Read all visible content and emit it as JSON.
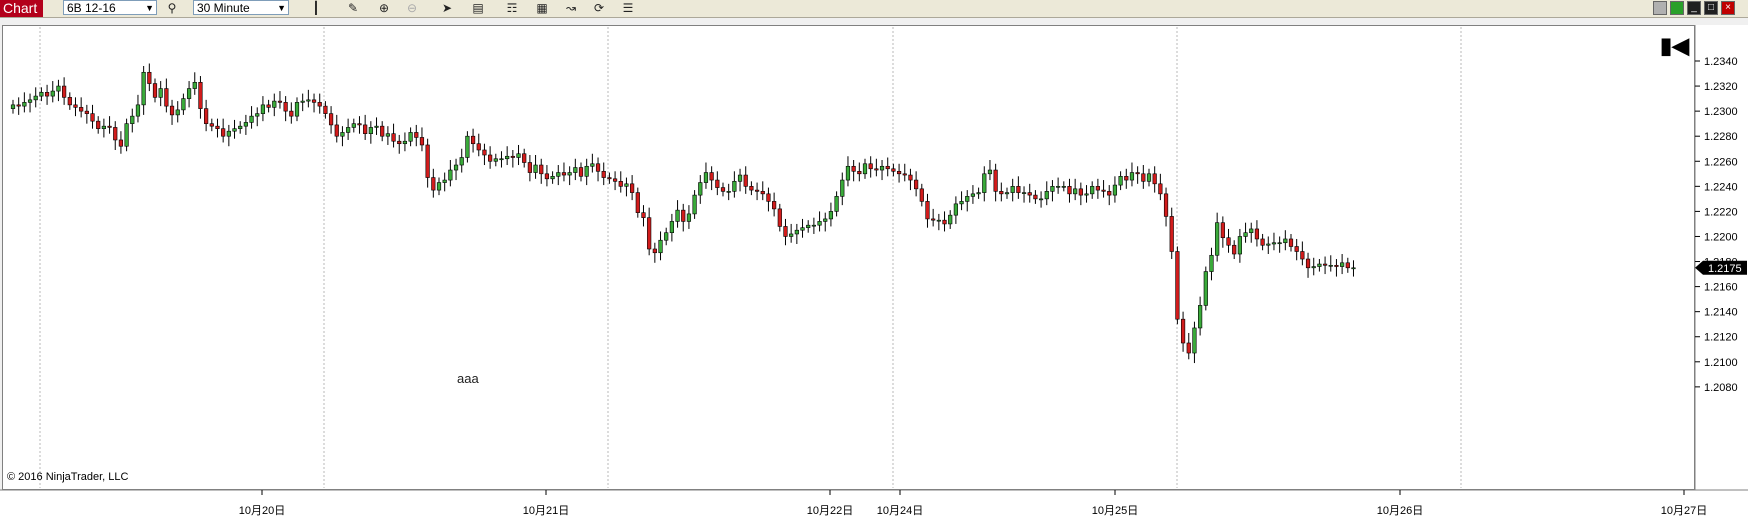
{
  "toolbar": {
    "app_label": "Chart",
    "instrument": "6B 12-16",
    "interval": "30 Minute",
    "icons": [
      "search-icon",
      "bar-type-icon",
      "draw-icon",
      "zoom-in-icon",
      "zoom-out-icon",
      "pointer-icon",
      "data-box-icon",
      "indicators-icon",
      "strategies-icon",
      "drawing-tools-icon",
      "reload-icon",
      "properties-icon"
    ],
    "window_icons": [
      "restore-icon",
      "tile-icon",
      "minimize-icon",
      "maximize-icon",
      "close-icon"
    ],
    "window_colors": [
      "#b0b0b0",
      "#2aa02a",
      "#202020",
      "#202020",
      "#c00000"
    ]
  },
  "chart": {
    "copyright": "© 2016 NinjaTrader, LLC",
    "annotation": "aaa",
    "current_price_label": "1.2175"
  },
  "chart_data": {
    "type": "candlestick",
    "instrument": "6B 12-16",
    "interval": "30 Minute",
    "ylim": [
      1.207,
      1.2355
    ],
    "y_ticks": [
      "1.2080",
      "1.2100",
      "1.2120",
      "1.2140",
      "1.2160",
      "1.2180",
      "1.2200",
      "1.2220",
      "1.2240",
      "1.2260",
      "1.2280",
      "1.2300",
      "1.2320",
      "1.2340"
    ],
    "x_ticks": [
      "10月20日",
      "10月21日",
      "10月22日",
      "10月24日",
      "10月25日",
      "10月26日",
      "10月27日"
    ],
    "current_price": 1.2175,
    "up_color": "#3aaa3a",
    "down_color": "#d21c1c",
    "grid": "vertical dashed session separators",
    "closes": [
      1.2305,
      1.2304,
      1.2307,
      1.2309,
      1.2312,
      1.2315,
      1.2312,
      1.2316,
      1.232,
      1.2311,
      1.2305,
      1.2303,
      1.23,
      1.2298,
      1.2292,
      1.2286,
      1.2288,
      1.2287,
      1.2277,
      1.2272,
      1.229,
      1.2296,
      1.2305,
      1.2331,
      1.2322,
      1.2311,
      1.2318,
      1.2304,
      1.2297,
      1.2301,
      1.231,
      1.2318,
      1.2323,
      1.2302,
      1.229,
      1.2288,
      1.2286,
      1.228,
      1.2284,
      1.2286,
      1.2288,
      1.2291,
      1.2296,
      1.2298,
      1.2305,
      1.2303,
      1.2308,
      1.2307,
      1.23,
      1.2296,
      1.2307,
      1.2308,
      1.2309,
      1.2307,
      1.2304,
      1.2298,
      1.2289,
      1.228,
      1.2283,
      1.2287,
      1.229,
      1.2289,
      1.2282,
      1.2287,
      1.2288,
      1.228,
      1.2282,
      1.2276,
      1.2274,
      1.2276,
      1.2283,
      1.2279,
      1.2273,
      1.2247,
      1.2237,
      1.2243,
      1.2245,
      1.2253,
      1.2257,
      1.2263,
      1.228,
      1.2274,
      1.2269,
      1.2265,
      1.226,
      1.2262,
      1.2262,
      1.2264,
      1.2263,
      1.2266,
      1.2259,
      1.2251,
      1.2257,
      1.225,
      1.2246,
      1.2248,
      1.2251,
      1.2249,
      1.2251,
      1.2255,
      1.2248,
      1.2256,
      1.2258,
      1.2252,
      1.2247,
      1.2246,
      1.2244,
      1.224,
      1.2242,
      1.2235,
      1.2219,
      1.2215,
      1.219,
      1.2187,
      1.2197,
      1.2203,
      1.2212,
      1.2221,
      1.2212,
      1.2218,
      1.2233,
      1.2243,
      1.2251,
      1.2245,
      1.2239,
      1.2236,
      1.2236,
      1.2244,
      1.2249,
      1.224,
      1.2237,
      1.2236,
      1.2234,
      1.2228,
      1.2222,
      1.2208,
      1.22,
      1.2202,
      1.2205,
      1.2207,
      1.2209,
      1.2209,
      1.2212,
      1.2214,
      1.222,
      1.2232,
      1.2245,
      1.2256,
      1.2252,
      1.225,
      1.2258,
      1.2254,
      1.2253,
      1.2256,
      1.2254,
      1.2252,
      1.225,
      1.2249,
      1.2245,
      1.2238,
      1.2228,
      1.2214,
      1.2213,
      1.2213,
      1.221,
      1.2217,
      1.2226,
      1.2228,
      1.2232,
      1.2234,
      1.2235,
      1.225,
      1.2253,
      1.2236,
      1.2234,
      1.2235,
      1.224,
      1.2235,
      1.2235,
      1.2233,
      1.223,
      1.223,
      1.2236,
      1.224,
      1.224,
      1.224,
      1.2234,
      1.2238,
      1.2233,
      1.2234,
      1.224,
      1.2237,
      1.2236,
      1.2233,
      1.2241,
      1.2248,
      1.2245,
      1.2251,
      1.225,
      1.2244,
      1.225,
      1.2242,
      1.2234,
      1.2216,
      1.2188,
      1.2134,
      1.2115,
      1.2107,
      1.2127,
      1.2145,
      1.2172,
      1.2185,
      1.2211,
      1.2199,
      1.2193,
      1.2186,
      1.22,
      1.2203,
      1.2206,
      1.2198,
      1.2193,
      1.2194,
      1.2195,
      1.2195,
      1.2198,
      1.2192,
      1.2188,
      1.2182,
      1.2175,
      1.2176,
      1.2178,
      1.2177,
      1.2177,
      1.2176,
      1.2179,
      1.2175,
      1.2175
    ]
  }
}
